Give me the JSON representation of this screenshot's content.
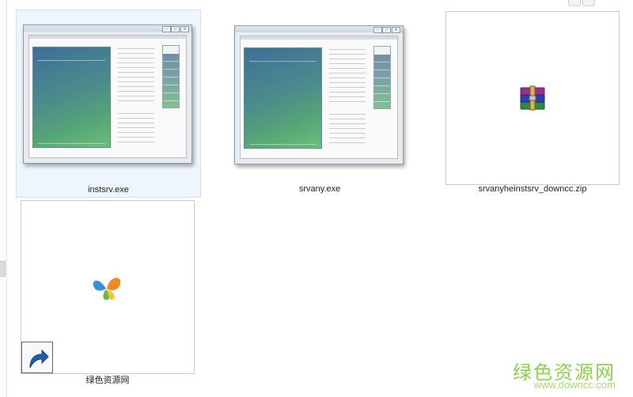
{
  "files": [
    {
      "name": "instsrv.exe",
      "selected": true,
      "type": "exe"
    },
    {
      "name": "srvany.exe",
      "selected": false,
      "type": "exe"
    },
    {
      "name": "srvanyheinstsrv_downcc.zip",
      "selected": false,
      "type": "zip"
    },
    {
      "name": "绿色资源网",
      "selected": false,
      "type": "shortcut"
    }
  ],
  "window_controls": [
    "–",
    "□",
    "✕"
  ],
  "icons": {
    "exe": "application-window-icon",
    "zip": "winrar-archive-icon",
    "shortcut": "msn-butterfly-icon",
    "overlay": "shortcut-arrow-icon"
  },
  "watermark": {
    "name": "绿色资源网",
    "url": "www.downcc.com"
  },
  "colors": {
    "selection_bg": "#eef5fd",
    "selection_border": "#cde3f9",
    "watermark": "#8dcf4b"
  }
}
